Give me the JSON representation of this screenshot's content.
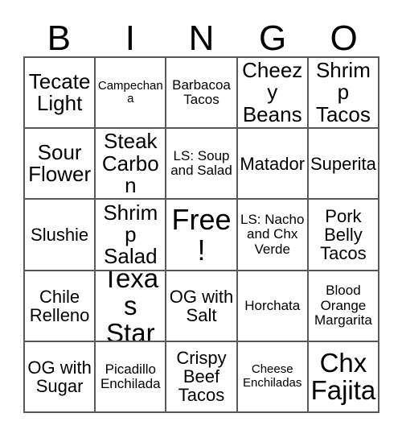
{
  "card": {
    "header_letters": [
      "B",
      "I",
      "N",
      "G",
      "O"
    ],
    "columns": 5,
    "rows": 5,
    "grid_line_color": "#5a5a5a",
    "background_color": "#ffffff",
    "text_color": "#000000",
    "cells": [
      [
        {
          "text": "Tecate Light",
          "size": "lg",
          "free": false
        },
        {
          "text": "Campechana",
          "size": "xs",
          "free": false
        },
        {
          "text": "Barbacoa Tacos",
          "size": "sm",
          "free": false
        },
        {
          "text": "Cheezy Beans",
          "size": "lg",
          "free": false
        },
        {
          "text": "Shrimp Tacos",
          "size": "lg",
          "free": false
        }
      ],
      [
        {
          "text": "Sour Flower",
          "size": "lg",
          "free": false
        },
        {
          "text": "Steak Carbon",
          "size": "lg",
          "free": false
        },
        {
          "text": "LS: Soup and Salad",
          "size": "sm",
          "free": false
        },
        {
          "text": "Matador",
          "size": "md",
          "free": false
        },
        {
          "text": "Superita",
          "size": "md",
          "free": false
        }
      ],
      [
        {
          "text": "Slushie",
          "size": "md",
          "free": false
        },
        {
          "text": "Shrimp Salad",
          "size": "lg",
          "free": false
        },
        {
          "text": "Free!",
          "size": "xl",
          "free": true
        },
        {
          "text": "LS: Nacho and Chx Verde",
          "size": "sm",
          "free": false
        },
        {
          "text": "Pork Belly Tacos",
          "size": "md",
          "free": false
        }
      ],
      [
        {
          "text": "Chile Relleno",
          "size": "md",
          "free": false
        },
        {
          "text": "Texas Star",
          "size": "xl",
          "free": false
        },
        {
          "text": "OG with Salt",
          "size": "md",
          "free": false
        },
        {
          "text": "Horchata",
          "size": "sm",
          "free": false
        },
        {
          "text": "Blood Orange Margarita",
          "size": "sm",
          "free": false
        }
      ],
      [
        {
          "text": "OG with Sugar",
          "size": "md",
          "free": false
        },
        {
          "text": "Picadillo Enchilada",
          "size": "sm",
          "free": false
        },
        {
          "text": "Crispy Beef Tacos",
          "size": "md",
          "free": false
        },
        {
          "text": "Cheese Enchiladas",
          "size": "xs",
          "free": false
        },
        {
          "text": "Chx Fajita",
          "size": "xl",
          "free": false
        }
      ]
    ]
  }
}
